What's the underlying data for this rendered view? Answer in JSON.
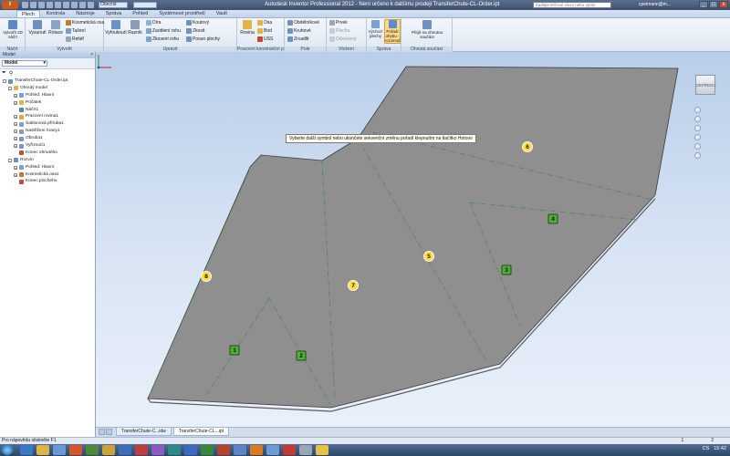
{
  "title_bar": {
    "app_button": "I",
    "qat_combo": "Obecné",
    "title": "Autodesk Inventor Professional 2012 - Není určeno k dalšímu prodeji    TransferChute-CL-Order.ipt",
    "help_search_placeholder": "Zadejte klíčové slovo nebo výraz",
    "user": "cpelmann@m...",
    "minimize": "_",
    "maximize": "□",
    "close": "x"
  },
  "ribbon_tabs": [
    "Plech",
    "Kontrola",
    "Nástroje",
    "Správa",
    "Pohled",
    "Systémové prostředí",
    "Vault"
  ],
  "ribbon": {
    "groups": [
      {
        "label": "Náčrt"
      },
      {
        "label": "Vytvořit"
      },
      {
        "label": "Upravit"
      },
      {
        "label": "Pracovní konstrukční prvky"
      },
      {
        "label": "Pole"
      },
      {
        "label": "Vložení"
      },
      {
        "label": "Správa"
      },
      {
        "label": "Ohnutá součást"
      }
    ],
    "buttons": {
      "start_sketch": "Vytvořit 2D náčrt",
      "vysunuti": "Vysunutí",
      "rotace": "Rotace",
      "kosmeticka_osa": "Kosmetická osa",
      "taseni": "Tažení",
      "relief": "Reliéf",
      "vyfoukat": "Vyfouknutí",
      "razník": "Razník",
      "dira": "Díra",
      "zaobleni_rohu": "Zaoblení rohu",
      "zkoseni_rohu": "Zkosení rohu",
      "koutovy": "Koutový",
      "zkosit": "Zkosit",
      "posun_plochy": "Posun plochy",
      "rovina": "Rovina",
      "osa": "Osa",
      "bod": "Bod",
      "uss": "USS",
      "obdelnikove": "Obdélníkové",
      "kruhove": "Kruhové",
      "zrcadlit": "Zrcadlit",
      "prvek": "Prvek",
      "plocha": "Plocha",
      "odvozeny": "Odvozený",
      "vychozi_plechy": "Výchozí plechy",
      "poradi_ohybu": "Pořadí ohybu - rozvinutí",
      "prejit_na_ohnutou": "Přejít na ohnutou součást"
    }
  },
  "browser": {
    "title": "Model",
    "combo": "Model",
    "tree": [
      {
        "label": "TransferChute-CL-Order.ipt",
        "level": 0,
        "icon": "part-icon",
        "expander": "-"
      },
      {
        "label": "Ohnutý model",
        "level": 1,
        "icon": "folder-icon",
        "expander": "-"
      },
      {
        "label": "Pohled: Hlavní",
        "level": 2,
        "icon": "view-icon",
        "expander": "+"
      },
      {
        "label": "Počátek",
        "level": 2,
        "icon": "folder-icon",
        "expander": "+"
      },
      {
        "label": "Náčrt1",
        "level": 2,
        "icon": "sketch-icon",
        "expander": ""
      },
      {
        "label": "Pracovní rovina1",
        "level": 2,
        "icon": "plane-icon",
        "expander": "+"
      },
      {
        "label": "Šablonová příruba1",
        "level": 2,
        "icon": "flange-icon",
        "expander": "+"
      },
      {
        "label": "Nastřižení hrany1",
        "level": 2,
        "icon": "rip-icon",
        "expander": "+"
      },
      {
        "label": "Obruba1",
        "level": 2,
        "icon": "hem-icon",
        "expander": "+"
      },
      {
        "label": "Vyříznutí1",
        "level": 2,
        "icon": "cut-icon",
        "expander": "+"
      },
      {
        "label": "Konec ohnutého",
        "level": 2,
        "icon": "end-icon",
        "expander": ""
      },
      {
        "label": "Rozvin",
        "level": 1,
        "icon": "flat-icon",
        "expander": "-"
      },
      {
        "label": "Pohled: Hlavní",
        "level": 2,
        "icon": "view-icon",
        "expander": "+"
      },
      {
        "label": "Kosmetická osa1",
        "level": 2,
        "icon": "axis-icon",
        "expander": "+"
      },
      {
        "label": "Konec plochého",
        "level": 2,
        "icon": "end-icon",
        "expander": ""
      }
    ]
  },
  "viewport": {
    "tooltip": "Vyberte další symbol nebo ukončete sekvenční změnu pořadí klepnutím na tlačítko Hotovo",
    "viewcube_label": "ZEPŘEDU",
    "plate_color": "#8f8f8f",
    "bend_line_color": "#4f8a4f",
    "bend_markers": [
      {
        "label": "1",
        "style": "square"
      },
      {
        "label": "2",
        "style": "square"
      },
      {
        "label": "3",
        "style": "square"
      },
      {
        "label": "4",
        "style": "square"
      },
      {
        "label": "5",
        "style": "circle"
      },
      {
        "label": "6",
        "style": "circle"
      },
      {
        "label": "7",
        "style": "circle"
      },
      {
        "label": "8",
        "style": "circle"
      }
    ]
  },
  "doc_tabs": [
    "TransferChute-C...idw",
    "TransferChute-CL...ipt"
  ],
  "status": {
    "help_text": "Pro nápovědu stiskněte F1",
    "num_left": "1",
    "num_right": "2"
  },
  "taskbar": {
    "lang": "CS",
    "clock": "15:42"
  }
}
